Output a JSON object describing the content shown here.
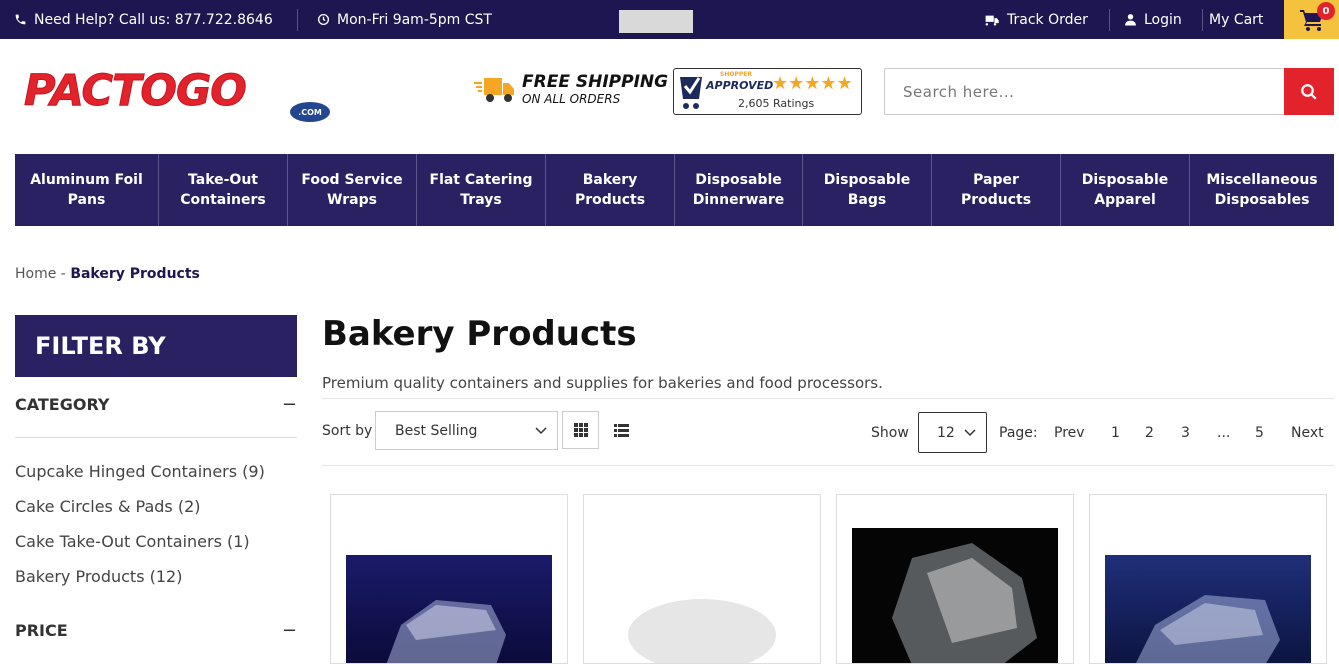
{
  "topbar": {
    "help": "Need Help? Call us: 877.722.8646",
    "hours": "Mon-Fri 9am-5pm CST",
    "track_order": "Track Order",
    "login": "Login",
    "my_cart": "My Cart",
    "cart_count": "0"
  },
  "brand": {
    "logo": "PACTOGO",
    "logo_suffix": ".COM"
  },
  "promo": {
    "line1": "FREE SHIPPING",
    "line2": "ON ALL ORDERS"
  },
  "badge": {
    "label": "APPROVED",
    "small": "SHOPPER",
    "stars": "★★★★★",
    "ratings": "2,605 Ratings"
  },
  "search": {
    "placeholder": "Search here..."
  },
  "nav": {
    "items": [
      {
        "label": "Aluminum Foil Pans"
      },
      {
        "label": "Take-Out Containers"
      },
      {
        "label": "Food Service Wraps"
      },
      {
        "label": "Flat Catering Trays"
      },
      {
        "label": "Bakery Products"
      },
      {
        "label": "Disposable Dinnerware"
      },
      {
        "label": "Disposable Bags"
      },
      {
        "label": "Paper Products"
      },
      {
        "label": "Disposable Apparel"
      },
      {
        "label": "Miscellaneous Disposables"
      }
    ]
  },
  "breadcrumb": {
    "home": "Home",
    "separator": "-",
    "current": "Bakery Products"
  },
  "sidebar": {
    "title": "FILTER BY",
    "category_title": "CATEGORY",
    "categories": [
      {
        "label": "Cupcake Hinged Containers (9)"
      },
      {
        "label": "Cake Circles & Pads (2)"
      },
      {
        "label": "Cake Take-Out Containers (1)"
      },
      {
        "label": "Bakery Products (12)"
      }
    ],
    "price_title": "PRICE",
    "collapse_symbol": "−"
  },
  "main": {
    "title": "Bakery Products",
    "description": "Premium quality containers and supplies for bakeries and food processors.",
    "sort_label": "Sort by",
    "sort_value": "Best Selling",
    "show_label": "Show",
    "show_value": "12",
    "page_label": "Page:",
    "prev": "Prev",
    "pages": [
      "1",
      "2",
      "3",
      "...",
      "5"
    ],
    "next": "Next"
  },
  "colors": {
    "navy": "#1d1650",
    "nav": "#2a2163",
    "accent_red": "#e2232c",
    "cart_yellow": "#f5c23d"
  }
}
